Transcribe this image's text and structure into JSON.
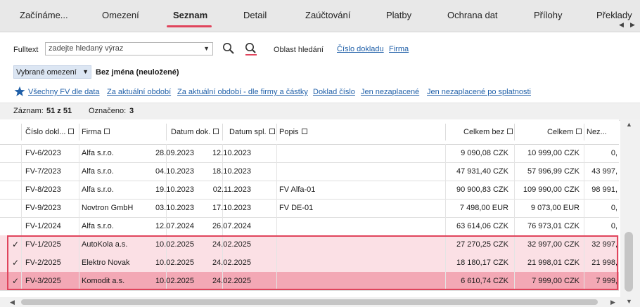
{
  "tabs": [
    {
      "label": "Začínáme..."
    },
    {
      "label": "Omezení"
    },
    {
      "label": "Seznam"
    },
    {
      "label": "Detail"
    },
    {
      "label": "Zaúčtování"
    },
    {
      "label": "Platby"
    },
    {
      "label": "Ochrana dat"
    },
    {
      "label": "Přílohy"
    },
    {
      "label": "Překlady"
    }
  ],
  "search": {
    "label": "Fulltext",
    "placeholder": "zadejte hledaný výraz",
    "area_label": "Oblast hledání",
    "area_links": [
      "Číslo dokladu",
      "Firma"
    ]
  },
  "filter": {
    "selected": "Vybrané omezení",
    "name": "Bez jména (neuložené)"
  },
  "quick_filters": [
    "Všechny FV dle data",
    "Za aktuální období",
    "Za aktuální období - dle firmy a částky",
    "Doklad číslo",
    "Jen nezaplacené",
    "Jen nezaplacené po splatnosti"
  ],
  "status": {
    "records_label": "Záznam:",
    "records_value": "51 z 51",
    "marked_label": "Označeno:",
    "marked_value": "3"
  },
  "columns": [
    "Číslo dokl...",
    "Firma",
    "Datum dok.",
    "Datum spl.",
    "Popis",
    "Celkem bez",
    "Celkem",
    "Nez..."
  ],
  "rows": [
    {
      "cislo": "FV-6/2023",
      "firma": "Alfa s.r.o.",
      "dok": "28.09.2023",
      "spl": "12.10.2023",
      "popis": "",
      "bez": "9 090,08 CZK",
      "celkem": "10 999,00 CZK",
      "nez": "0,",
      "sel": 0
    },
    {
      "cislo": "FV-7/2023",
      "firma": "Alfa s.r.o.",
      "dok": "04.10.2023",
      "spl": "18.10.2023",
      "popis": "",
      "bez": "47 931,40 CZK",
      "celkem": "57 996,99 CZK",
      "nez": "43 997,",
      "sel": 0
    },
    {
      "cislo": "FV-8/2023",
      "firma": "Alfa s.r.o.",
      "dok": "19.10.2023",
      "spl": "02.11.2023",
      "popis": "FV Alfa-01",
      "bez": "90 900,83 CZK",
      "celkem": "109 990,00 CZK",
      "nez": "98 991,",
      "sel": 0
    },
    {
      "cislo": "FV-9/2023",
      "firma": "Novtron GmbH",
      "dok": "03.10.2023",
      "spl": "17.10.2023",
      "popis": "FV DE-01",
      "bez": "7 498,00 EUR",
      "celkem": "9 073,00 EUR",
      "nez": "0,",
      "sel": 0
    },
    {
      "cislo": "FV-1/2024",
      "firma": "Alfa s.r.o.",
      "dok": "12.07.2024",
      "spl": "26.07.2024",
      "popis": "",
      "bez": "63 614,06 CZK",
      "celkem": "76 973,01 CZK",
      "nez": "0,",
      "sel": 0
    },
    {
      "cislo": "FV-1/2025",
      "firma": "AutoKola a.s.",
      "dok": "10.02.2025",
      "spl": "24.02.2025",
      "popis": "",
      "bez": "27 270,25 CZK",
      "celkem": "32 997,00 CZK",
      "nez": "32 997,",
      "sel": 1
    },
    {
      "cislo": "FV-2/2025",
      "firma": "Elektro Novak",
      "dok": "10.02.2025",
      "spl": "24.02.2025",
      "popis": "",
      "bez": "18 180,17 CZK",
      "celkem": "21 998,01 CZK",
      "nez": "21 998,",
      "sel": 1
    },
    {
      "cislo": "FV-3/2025",
      "firma": "Komodit a.s.",
      "dok": "10.02.2025",
      "spl": "24.02.2025",
      "popis": "",
      "bez": "6 610,74 CZK",
      "celkem": "7 999,00 CZK",
      "nez": "7 999,",
      "sel": 2
    }
  ],
  "icons": {
    "search": "search-icon",
    "clear_search": "clear-search-icon",
    "star": "star-icon",
    "check": "check-icon"
  },
  "colors": {
    "accent": "#e0445c",
    "link": "#1f5fa8",
    "selected_row": "#fbe0e5",
    "active_row": "#f3a8b5"
  }
}
